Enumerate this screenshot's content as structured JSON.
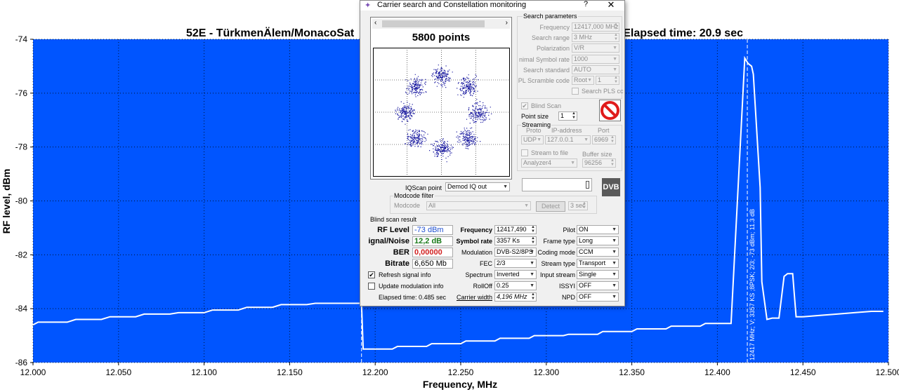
{
  "chart_data": {
    "type": "line",
    "title": "52E - TürkmenÄlem/MonacoSat",
    "title_right": "Elapsed time: 20.9 sec",
    "xlabel": "Frequency, MHz",
    "ylabel": "RF level, dBm",
    "xlim": [
      12.0,
      12.5
    ],
    "ylim": [
      -86,
      -74
    ],
    "x_ticks": [
      "12.000",
      "12.050",
      "12.100",
      "12.150",
      "12.200",
      "12.250",
      "12.300",
      "12.350",
      "12.400",
      "12.450",
      "12.500"
    ],
    "y_ticks": [
      "-74",
      "-76",
      "-78",
      "-80",
      "-82",
      "-84",
      "-86"
    ],
    "background_color": "#0055ff",
    "grid": true,
    "series": [
      {
        "color": "#ffffff",
        "x": [
          12.0,
          12.003,
          12.02,
          12.025,
          12.04,
          12.045,
          12.06,
          12.065,
          12.08,
          12.085,
          12.1,
          12.105,
          12.12,
          12.125,
          12.14,
          12.145,
          12.16,
          12.165,
          12.18,
          12.19,
          12.192,
          12.193,
          12.21,
          12.213,
          12.23,
          12.233,
          12.25,
          12.253,
          12.27,
          12.273,
          12.29,
          12.293,
          12.31,
          12.313,
          12.33,
          12.333,
          12.35,
          12.353,
          12.37,
          12.373,
          12.39,
          12.393,
          12.405,
          12.408,
          12.416,
          12.418,
          12.42,
          12.421,
          12.425,
          12.426,
          12.429,
          12.432,
          12.436,
          12.439,
          12.441,
          12.444,
          12.446,
          12.45,
          12.46,
          12.47,
          12.48,
          12.49,
          12.497
        ],
        "y": [
          -84.6,
          -84.5,
          -84.5,
          -84.4,
          -84.4,
          -84.3,
          -84.3,
          -84.2,
          -84.2,
          -84.15,
          -84.15,
          -84.05,
          -84.05,
          -83.95,
          -83.95,
          -83.85,
          -83.85,
          -83.8,
          -83.8,
          -83.8,
          -83.8,
          -85.5,
          -85.5,
          -85.4,
          -85.4,
          -85.3,
          -85.3,
          -85.2,
          -85.2,
          -85.1,
          -85.1,
          -85.0,
          -85.0,
          -84.95,
          -84.95,
          -84.85,
          -84.85,
          -84.75,
          -84.75,
          -84.65,
          -84.65,
          -84.55,
          -84.55,
          -84.55,
          -74.7,
          -74.9,
          -75.0,
          -75.3,
          -79.5,
          -83.0,
          -84.4,
          -84.35,
          -84.35,
          -82.8,
          -82.7,
          -82.7,
          -84.3,
          -84.3,
          -84.25,
          -84.2,
          -84.15,
          -84.1,
          -84.1
        ]
      }
    ],
    "markers": [
      {
        "x": 12.192,
        "color": "#ffffff",
        "label": ""
      },
      {
        "x": 12.4175,
        "color": "#ffffff",
        "label": "12417 MHz; V; 3357 KS ;8PSK; 2/3; -73 dBm; 11.3 dB"
      }
    ]
  },
  "dialog": {
    "title": "Carrier search and Constellation monitoring",
    "help": "?",
    "close": "✕",
    "app_icon": "wand-icon",
    "constellation": {
      "points_label": "5800 points",
      "scroll_left": "‹",
      "scroll_right": "›"
    },
    "iqscan": {
      "label": "IQScan point",
      "value": "Demod IQ out"
    },
    "modcode_filter": {
      "title": "Modcode filter",
      "label": "Modcode",
      "value": "All",
      "detect": "Detect",
      "sec": "3 sec"
    },
    "search_params": {
      "title": "Search parameters",
      "frequency_label": "Frequency",
      "frequency": "12417,000 MHz",
      "range_label": "Search range",
      "range": "3 MHz",
      "polarization_label": "Polarization",
      "polarization": "V/R",
      "min_sr_label": "nimal Symbol rate",
      "min_sr": "1000",
      "standard_label": "Search standard",
      "standard": "AUTO",
      "pl_label": "PL Scramble code",
      "pl_mode": "Root",
      "pl_value": "1",
      "search_pls": "Search PLS cc"
    },
    "blind_scan": {
      "label": "Blind Scan",
      "checked": "✔"
    },
    "point_size": {
      "label": "Point size",
      "value": "1"
    },
    "streaming": {
      "title": "Streaming",
      "proto_label": "Proto",
      "proto": "UDP",
      "ip_label": "IP-address",
      "ip": "127.0.0.1",
      "port_label": "Port",
      "port": "6969",
      "to_file": "Stream to file",
      "buffer_label": "Buffer size",
      "buffer": "96256",
      "analyzer": "Analyzer4"
    },
    "dvb_logo": "DVB",
    "result": {
      "title": "Blind scan result",
      "rf_label": "RF Level",
      "rf": "-73 dBm",
      "rf_color": "#1f4fd1",
      "sn_label": "ignal/Noise",
      "sn": "12,2 dB",
      "sn_color": "#1a7a1a",
      "ber_label": "BER",
      "ber": "0,00000",
      "ber_color": "#d11f1f",
      "bitrate_label": "Bitrate",
      "bitrate": "6,650 Mb",
      "refresh": "Refresh signal info",
      "refresh_checked": "✔",
      "update_mod": "Update modulation info",
      "elapsed": "Elapsed time: 0.485 sec",
      "freq_label": "Frequency",
      "freq": "12417,490",
      "sr_label": "Symbol rate",
      "sr": "3357 Ks",
      "mod_label": "Modulation",
      "mod": "DVB-S2/8PS",
      "fec_label": "FEC",
      "fec": "2/3",
      "spectrum_label": "Spectrum",
      "spectrum": "Inverted",
      "rolloff_label": "RollOff",
      "rolloff": "0.25",
      "carrier_label": "Carrier width",
      "carrier": "4,196 MHz",
      "pilot_label": "Pilot",
      "pilot": "ON",
      "frame_label": "Frame type",
      "frame": "Long",
      "coding_label": "Coding mode",
      "coding": "CCM",
      "stream_type_label": "Stream type",
      "stream_type": "Transport",
      "input_stream_label": "Input stream",
      "input_stream": "Single",
      "issyi_label": "ISSYI",
      "issyi": "OFF",
      "npd_label": "NPD",
      "npd": "OFF"
    }
  }
}
